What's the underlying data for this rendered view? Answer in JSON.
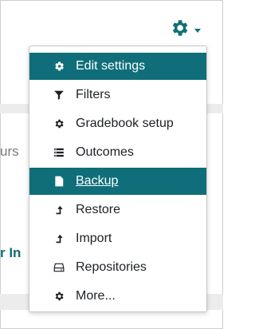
{
  "background": {
    "partial_text_1": "urs",
    "partial_text_2": "r In"
  },
  "menu_trigger": {
    "icon": "gear-icon",
    "caret_icon": "caret-down-icon"
  },
  "menu": {
    "items": [
      {
        "label": "Edit settings",
        "icon": "gear-icon",
        "active": true
      },
      {
        "label": "Filters",
        "icon": "filter-icon"
      },
      {
        "label": "Gradebook setup",
        "icon": "gear-icon"
      },
      {
        "label": "Outcomes",
        "icon": "list-icon"
      },
      {
        "label": "Backup",
        "icon": "file-archive-icon",
        "active": true,
        "hover": true
      },
      {
        "label": "Restore",
        "icon": "level-up-icon"
      },
      {
        "label": "Import",
        "icon": "level-up-icon"
      },
      {
        "label": "Repositories",
        "icon": "hdd-icon"
      },
      {
        "label": "More...",
        "icon": "gear-icon"
      }
    ]
  },
  "colors": {
    "accent": "#0f6e79",
    "text": "#1d2125"
  }
}
